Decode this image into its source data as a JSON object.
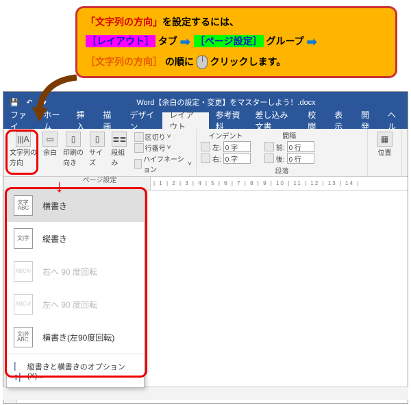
{
  "callout": {
    "line1_red": "「文字列の方向」",
    "line1_black": "を設定するには、",
    "line2_layout": "［レイアウト］",
    "line2_tab": "タブ",
    "line2_page": "［ページ設定］",
    "line2_group": "グループ",
    "line3_dir": "［文字列の方向］",
    "line3_order": "の順に",
    "line3_click": "クリック",
    "line3_end": "します。"
  },
  "titlebar": {
    "doc_title": "Word【余白の設定・変更】をマスターしよう！.docx",
    "save_icon": "💾",
    "undo_icon": "↶",
    "dropdown_icon": "▾"
  },
  "tabs": [
    "ファイ",
    "ホーム",
    "挿入",
    "描画",
    "デザイン",
    "レイアウト",
    "参考資料",
    "差し込み文書",
    "校閲",
    "表示",
    "開発",
    "ヘル"
  ],
  "active_tab_index": 5,
  "ribbon": {
    "group1_label": "ページ設定",
    "btn_text_dir": "文字列の\n方向",
    "btn_margin": "余白",
    "btn_orient": "印刷の\n向き",
    "btn_size": "サイズ",
    "btn_columns": "段組み",
    "breaks": "区切り",
    "line_no": "行番号",
    "hyphen": "ハイフネーション",
    "group2_label": "段落",
    "indent_title": "インデント",
    "spacing_title": "間隔",
    "left_label": "左:",
    "right_label": "右:",
    "before_label": "前:",
    "after_label": "後:",
    "left_val": "0 字",
    "right_val": "0 字",
    "before_val": "0 行",
    "after_val": "0 行",
    "pos_label": "位置"
  },
  "ruler_ticks": "| 1 | 2 | 3 | 4 | 5 | 6 | 7 | 8 | 9 | 10 | 11 | 12 | 13 | 14 |",
  "dropdown": {
    "items": [
      {
        "label": "横書き",
        "icon": "文字\nABC",
        "selected": true,
        "disabled": false
      },
      {
        "label": "縦書き",
        "icon": "文|字",
        "selected": false,
        "disabled": false
      },
      {
        "label": "右へ 90 度回転",
        "icon": "ABC↻",
        "selected": false,
        "disabled": true
      },
      {
        "label": "左へ 90 度回転",
        "icon": "ABC↺",
        "selected": false,
        "disabled": true
      },
      {
        "label": "横書き(左90度回転)",
        "icon": "文|外\nABC",
        "selected": false,
        "disabled": false
      }
    ],
    "options_label": "縦書きと横書きのオプション(X)..."
  },
  "statusbar": {
    "page": ""
  }
}
